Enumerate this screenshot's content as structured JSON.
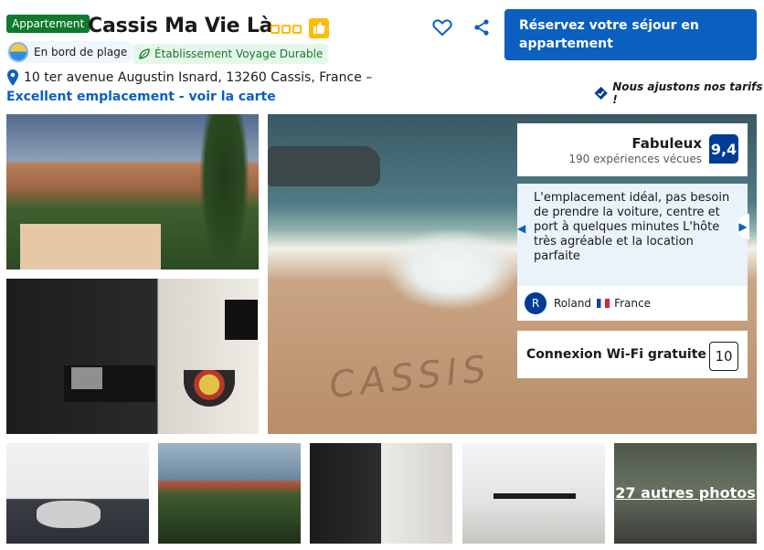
{
  "property": {
    "type_badge": "Appartement",
    "name": "Cassis Ma Vie Là",
    "stars": 3,
    "beach_badge": "En bord de plage",
    "sustainability_badge": "Établissement Voyage Durable",
    "address": "10 ter avenue Augustin Isnard, 13260 Cassis, France –",
    "map_link": "Excellent emplacement - voir la carte",
    "price_match": "Nous ajustons nos tarifs !"
  },
  "actions": {
    "reserve_button": "Réservez votre séjour en appartement"
  },
  "review": {
    "score_word": "Fabuleux",
    "review_count": "190 expériences vécues",
    "score": "9,4",
    "quote": "L'emplacement idéal, pas besoin de prendre la voiture, centre et port à quelques minutes L'hôte très agréable et la location parfaite",
    "reviewer_initial": "R",
    "reviewer_name": "Roland",
    "reviewer_country": "France"
  },
  "wifi": {
    "label": "Connexion Wi-Fi gratuite",
    "score": "10"
  },
  "gallery": {
    "photo_text": "CASSIS",
    "more_photos": "27 autres photos"
  },
  "colors": {
    "brand_blue": "#0b5fbf",
    "score_navy": "#003b95",
    "badge_green": "#0f7a2e",
    "star_yellow": "#febb02"
  },
  "icons": [
    "heart-icon",
    "share-icon",
    "beach-icon",
    "leaf-icon",
    "location-pin-icon",
    "price-match-check-icon",
    "chevron-left-icon",
    "chevron-right-icon",
    "france-flag-icon",
    "thumbs-up-icon"
  ]
}
